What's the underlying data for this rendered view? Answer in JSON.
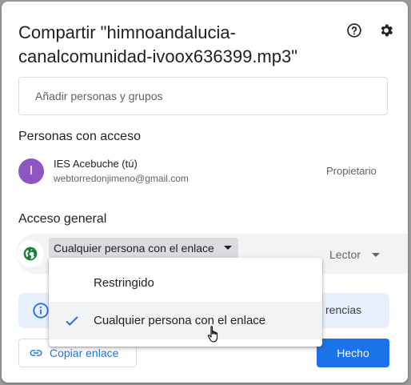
{
  "dialog": {
    "title": "Compartir \"himnoandalucia-canalcomunidad-ivoox636399.mp3\"",
    "help_icon": "help-circle-icon",
    "settings_icon": "gear-icon"
  },
  "add_people": {
    "placeholder": "Añadir personas y grupos"
  },
  "people_section": {
    "title": "Personas con acceso",
    "person": {
      "avatar_letter": "I",
      "avatar_color": "#8e56c2",
      "name": "IES Acebuche (tú)",
      "email": "webtorredonjimeno@gmail.com",
      "role": "Propietario"
    }
  },
  "general_access": {
    "title": "Acceso general",
    "selected": "Cualquier persona con el enlace",
    "role": "Lector",
    "options": [
      {
        "label": "Restringido",
        "selected": false
      },
      {
        "label": "Cualquier persona con el enlace",
        "selected": true
      }
    ]
  },
  "info_banner": {
    "text_visible": "rencias"
  },
  "footer": {
    "copy_link_label": "Copiar enlace",
    "done_label": "Hecho"
  },
  "colors": {
    "accent": "#1a73e8",
    "globe": "#188038",
    "banner_bg": "#e8f0fe"
  }
}
